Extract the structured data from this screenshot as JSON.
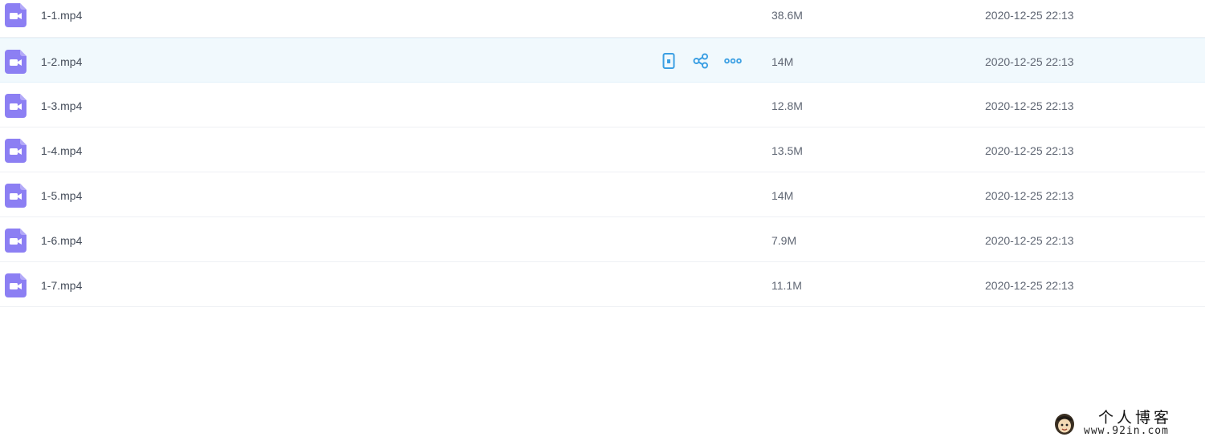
{
  "files": [
    {
      "name": "1-1.mp4",
      "size": "38.6M",
      "date": "2020-12-25 22:13"
    },
    {
      "name": "1-2.mp4",
      "size": "14M",
      "date": "2020-12-25 22:13"
    },
    {
      "name": "1-3.mp4",
      "size": "12.8M",
      "date": "2020-12-25 22:13"
    },
    {
      "name": "1-4.mp4",
      "size": "13.5M",
      "date": "2020-12-25 22:13"
    },
    {
      "name": "1-5.mp4",
      "size": "14M",
      "date": "2020-12-25 22:13"
    },
    {
      "name": "1-6.mp4",
      "size": "7.9M",
      "date": "2020-12-25 22:13"
    },
    {
      "name": "1-7.mp4",
      "size": "11.1M",
      "date": "2020-12-25 22:13"
    }
  ],
  "hover_actions": [
    "phone-icon",
    "share-icon",
    "more-icon"
  ],
  "colors": {
    "file_icon": "#8c7ff3",
    "action_icon": "#3b9fe3",
    "hover_row": "#f1f9fd"
  },
  "watermark": {
    "title": "个人博客",
    "url": "www.92in.com"
  }
}
